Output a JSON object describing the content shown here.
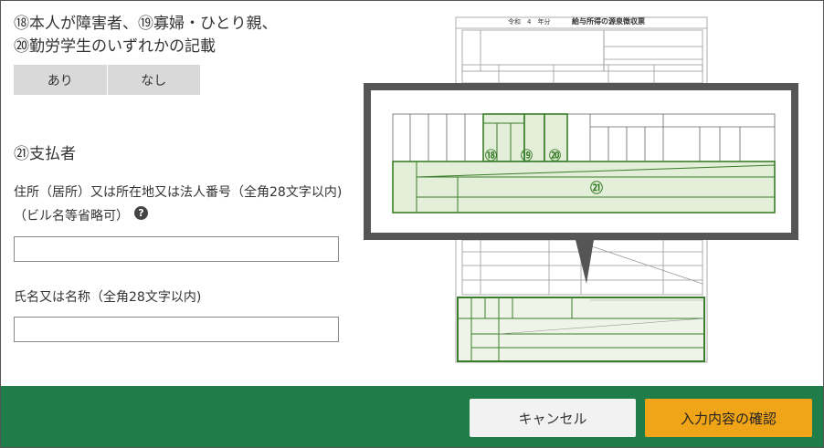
{
  "section18": {
    "title_line1": "⑱本人が障害者、⑲寡婦・ひとり親、",
    "title_line2": "⑳勤労学生のいずれかの記載",
    "option_yes": "あり",
    "option_no": "なし"
  },
  "section21": {
    "title": "㉑支払者",
    "address_label_line1": "住所（居所）又は所在地又は法人番号（全角28文字以内)",
    "address_label_line2": "（ビル名等省略可）",
    "help_icon": "?",
    "address_value": "",
    "name_label": "氏名又は名称（全角28文字以内)",
    "name_value": ""
  },
  "form_image": {
    "header_year": "令和　4　年分",
    "header_title": "給与所得の源泉徴収票",
    "callout_18": "⑱",
    "callout_19": "⑲",
    "callout_20": "⑳",
    "callout_21": "㉑"
  },
  "footer": {
    "cancel_label": "キャンセル",
    "confirm_label": "入力内容の確認"
  },
  "colors": {
    "footer_bg": "#1e7d49",
    "confirm_bg": "#f0a418",
    "cancel_bg": "#f2f2f2",
    "highlight_green": "#3a7d2a"
  }
}
